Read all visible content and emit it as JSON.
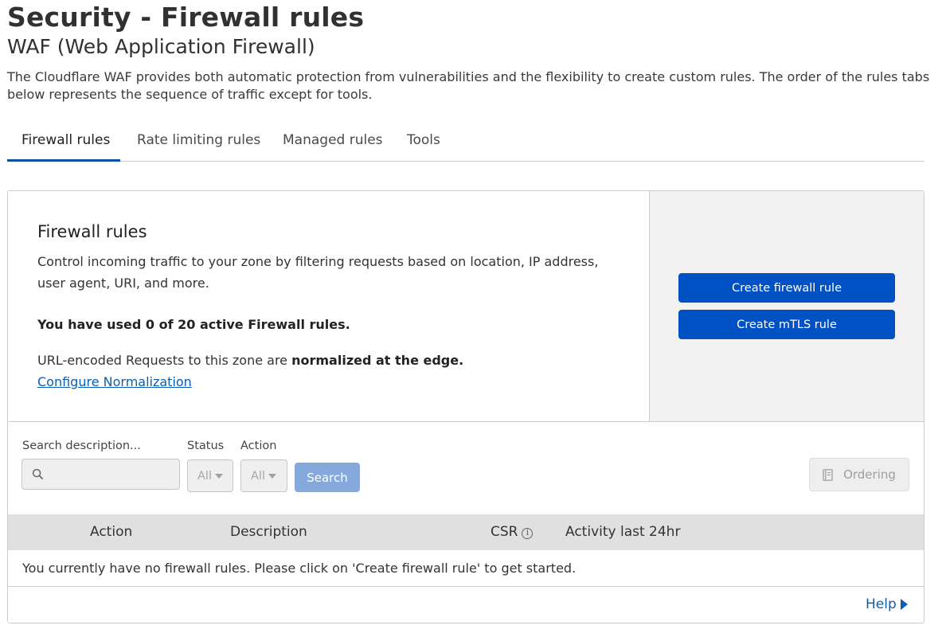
{
  "page": {
    "title": "Security - Firewall rules",
    "subtitle": "WAF (Web Application Firewall)",
    "description": "The Cloudflare WAF provides both automatic protection from vulnerabilities and the flexibility to create custom rules. The order of the rules tabs below represents the sequence of traffic except for tools."
  },
  "tabs": [
    {
      "label": "Firewall rules",
      "active": true
    },
    {
      "label": "Rate limiting rules",
      "active": false
    },
    {
      "label": "Managed rules",
      "active": false
    },
    {
      "label": "Tools",
      "active": false
    }
  ],
  "firewall_section": {
    "title": "Firewall rules",
    "description": "Control incoming traffic to your zone by filtering requests based on location, IP address, user agent, URI, and more.",
    "usage": "You have used 0 of 20 active Firewall rules.",
    "normalization_prefix": "URL-encoded Requests to this zone are ",
    "normalization_bold": "normalized at the edge.",
    "configure_link": "Configure Normalization"
  },
  "actions": {
    "create_firewall_rule": "Create firewall rule",
    "create_mtls_rule": "Create mTLS rule"
  },
  "filters": {
    "search_label": "Search description...",
    "search_value": "",
    "status_label": "Status",
    "status_value": "All",
    "action_label": "Action",
    "action_value": "All",
    "search_button": "Search",
    "ordering_button": "Ordering"
  },
  "table": {
    "columns": [
      "Action",
      "Description",
      "CSR",
      "Activity last 24hr"
    ],
    "empty_message": "You currently have no firewall rules. Please click on 'Create firewall rule' to get started."
  },
  "help_link": "Help",
  "colors": {
    "primary": "#0051c3",
    "link": "#0a5fb4",
    "disabled_button": "#86a9dd"
  }
}
